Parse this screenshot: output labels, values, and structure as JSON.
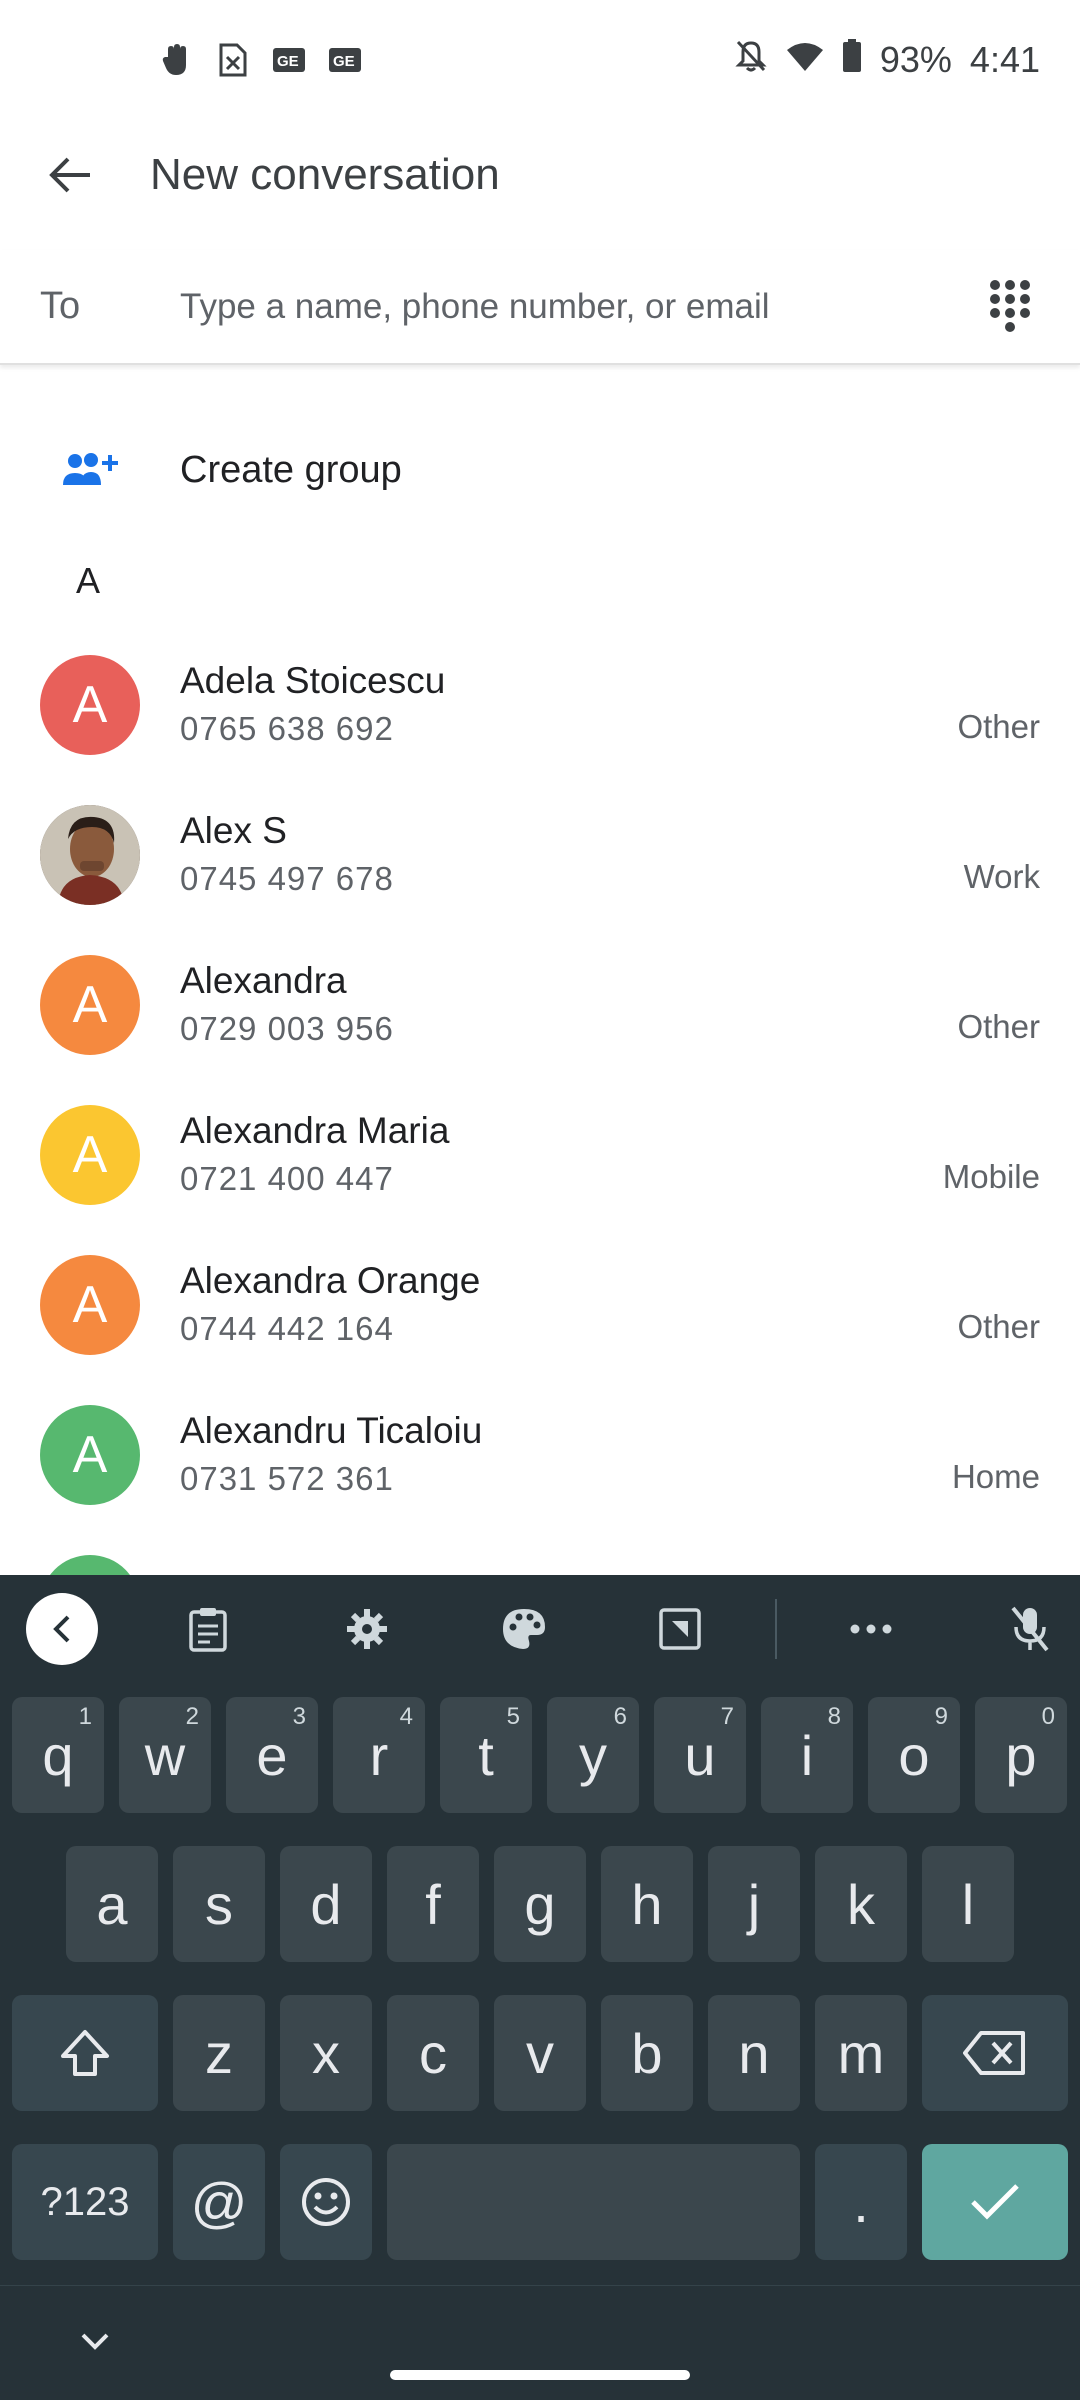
{
  "status_bar": {
    "battery": "93%",
    "time": "4:41",
    "icons": [
      "gesture-icon",
      "sim-off-icon",
      "ge-badge-icon",
      "ge-badge-icon",
      "bell-off-icon",
      "wifi-icon",
      "battery-icon"
    ]
  },
  "app_bar": {
    "title": "New conversation",
    "back_icon": "back-arrow-icon"
  },
  "to_field": {
    "label": "To",
    "placeholder": "Type a name, phone number, or email",
    "value": ""
  },
  "create_group": {
    "label": "Create group",
    "icon": "group-add-icon"
  },
  "section_letter": "A",
  "contacts": [
    {
      "initial": "A",
      "name": "Adela Stoicescu",
      "phone": "0765 638 692",
      "type": "Other",
      "color": "#e8605a"
    },
    {
      "initial": "",
      "name": "Alex S",
      "phone": "0745 497 678",
      "type": "Work",
      "color": "#5b4a3e",
      "photo": true
    },
    {
      "initial": "A",
      "name": "Alexandra",
      "phone": "0729 003 956",
      "type": "Other",
      "color": "#f5893f"
    },
    {
      "initial": "A",
      "name": "Alexandra Maria",
      "phone": "0721 400 447",
      "type": "Mobile",
      "color": "#fbc630"
    },
    {
      "initial": "A",
      "name": "Alexandra Orange",
      "phone": "0744 442 164",
      "type": "Other",
      "color": "#f5893f"
    },
    {
      "initial": "A",
      "name": "Alexandru Ticaloiu",
      "phone": "0731 572 361",
      "type": "Home",
      "color": "#57b86f"
    }
  ],
  "keyboard": {
    "row1": [
      {
        "key": "q",
        "hint": "1"
      },
      {
        "key": "w",
        "hint": "2"
      },
      {
        "key": "e",
        "hint": "3"
      },
      {
        "key": "r",
        "hint": "4"
      },
      {
        "key": "t",
        "hint": "5"
      },
      {
        "key": "y",
        "hint": "6"
      },
      {
        "key": "u",
        "hint": "7"
      },
      {
        "key": "i",
        "hint": "8"
      },
      {
        "key": "o",
        "hint": "9"
      },
      {
        "key": "p",
        "hint": "0"
      }
    ],
    "row2": [
      "a",
      "s",
      "d",
      "f",
      "g",
      "h",
      "j",
      "k",
      "l"
    ],
    "row3": [
      "z",
      "x",
      "c",
      "v",
      "b",
      "n",
      "m"
    ],
    "symbols_label": "?123",
    "at_label": "@",
    "period_label": "."
  },
  "colors": {
    "keyboard_bg": "#263238",
    "key_bg": "#3b474d",
    "enter_bg": "#5fa7a0",
    "accent": "#1a73e8"
  }
}
